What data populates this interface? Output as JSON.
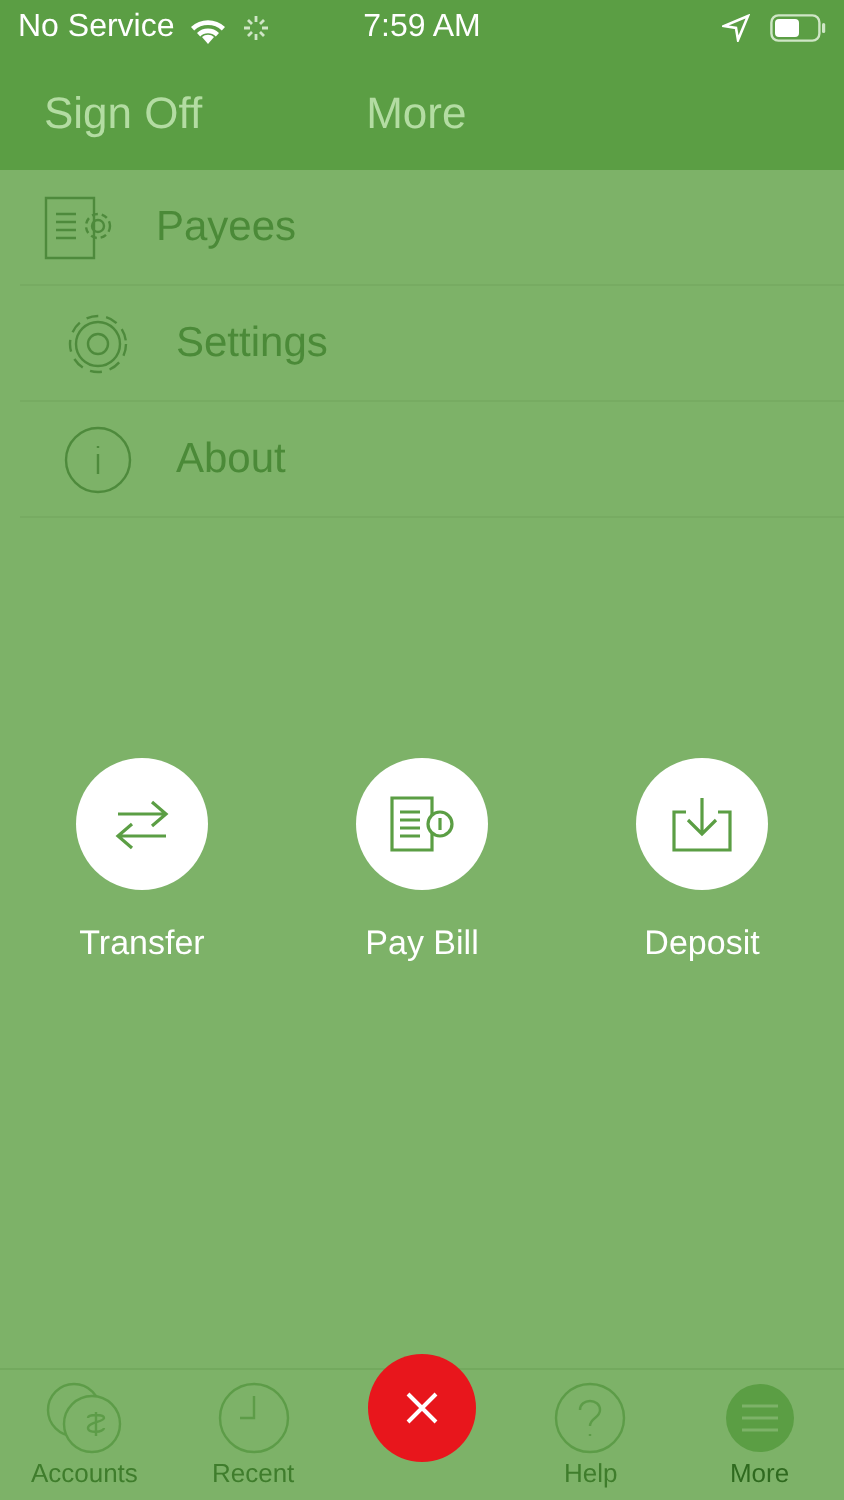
{
  "status_bar": {
    "carrier": "No Service",
    "time": "7:59 AM"
  },
  "nav": {
    "left": "Sign Off",
    "title": "More"
  },
  "menu": [
    {
      "label": "Payees"
    },
    {
      "label": "Settings"
    },
    {
      "label": "About"
    }
  ],
  "actions": [
    {
      "label": "Transfer"
    },
    {
      "label": "Pay Bill"
    },
    {
      "label": "Deposit"
    }
  ],
  "tab_bar": [
    {
      "label": "Accounts",
      "selected": false
    },
    {
      "label": "Recent",
      "selected": false
    },
    {
      "label": "Help",
      "selected": false
    },
    {
      "label": "More",
      "selected": true
    }
  ]
}
